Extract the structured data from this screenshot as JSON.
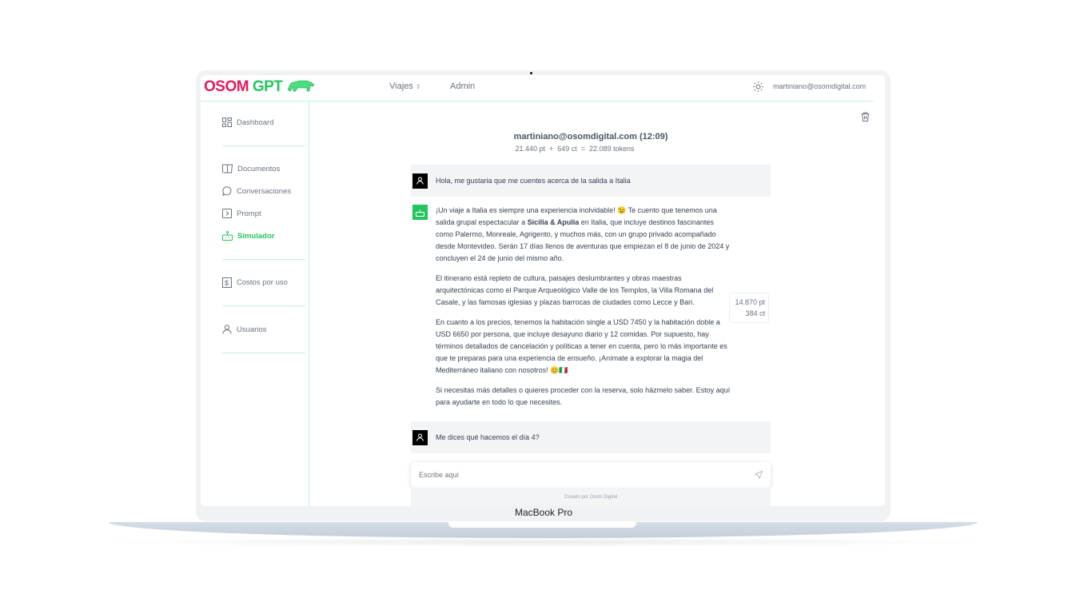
{
  "app": {
    "logo_osom": "OSOM",
    "logo_gpt": "GPT",
    "accent": "#22c55e",
    "brand": "#e11d5c"
  },
  "header": {
    "nav": [
      {
        "label": "Viajes"
      },
      {
        "label": "Admin"
      }
    ],
    "user_email": "martiniano@osomdigital.com"
  },
  "sidebar": {
    "items": [
      {
        "label": "Dashboard",
        "icon": "dashboard-icon"
      },
      {
        "label": "Documentos",
        "icon": "book-icon"
      },
      {
        "label": "Conversaciones",
        "icon": "chat-icon"
      },
      {
        "label": "Prompt",
        "icon": "prompt-icon"
      },
      {
        "label": "Simulador",
        "icon": "robot-icon",
        "active": true
      },
      {
        "label": "Costos por uso",
        "icon": "receipt-icon"
      },
      {
        "label": "Usuarios",
        "icon": "user-icon"
      }
    ]
  },
  "conversation": {
    "title": "martiniano@osomdigital.com (12:09)",
    "tokens": "21.440 pt  +  649 ct  =  22.089 tokens",
    "messages": [
      {
        "role": "user",
        "text": "Hola, me gustaria que me cuentes acerca de la salida a Italia"
      },
      {
        "role": "bot",
        "p1a": "¡Un viaje a Italia es siempre una experiencia inolvidable! 😉 Te cuento que tenemos una salida grupal espectacular a ",
        "p1b": "Sicilia & Apulia",
        "p1c": " en Italia, que incluye destinos fascinantes como Palermo, Monreale, Agrigento, y muchos más, con un grupo privado acompañado desde Montevideo. Serán 17 días llenos de aventuras que empiezan el 8 de junio de 2024 y concluyen el 24 de junio del mismo año.",
        "p2": "El itinerario está repleto de cultura, paisajes deslumbrantes y obras maestras arquitectónicas como el Parque Arqueológico Valle de los Templos, la Villa Romana del Casale, y las famosas iglesias y plazas barrocas de ciudades como Lecce y Bari.",
        "p3": "En cuanto a los precios, tenemos la habitación single a USD 7450 y la habitación doble a USD 6650 por persona, que incluye desayuno diario y 12 comidas. Por supuesto, hay términos detallados de cancelación y políticas a tener en cuenta, pero lo más importante es que te preparas para una experiencia de ensueño. ¡Anímate a explorar la magia del Mediterráneo italiano con nosotros! 😊🇮🇹",
        "p4": "Si necesitas más detalles o quieres proceder con la reserva, solo házmelo saber. Estoy aquí para ayudarte en todo lo que necesites.",
        "pt": "14.870 pt",
        "ct": "384 ct"
      },
      {
        "role": "user",
        "text": "Me dices qué hacemos el día 4?"
      }
    ]
  },
  "composer": {
    "placeholder": "Escribe aquí"
  },
  "footer": "Creado por Osom Digital",
  "device_label": "MacBook Pro"
}
